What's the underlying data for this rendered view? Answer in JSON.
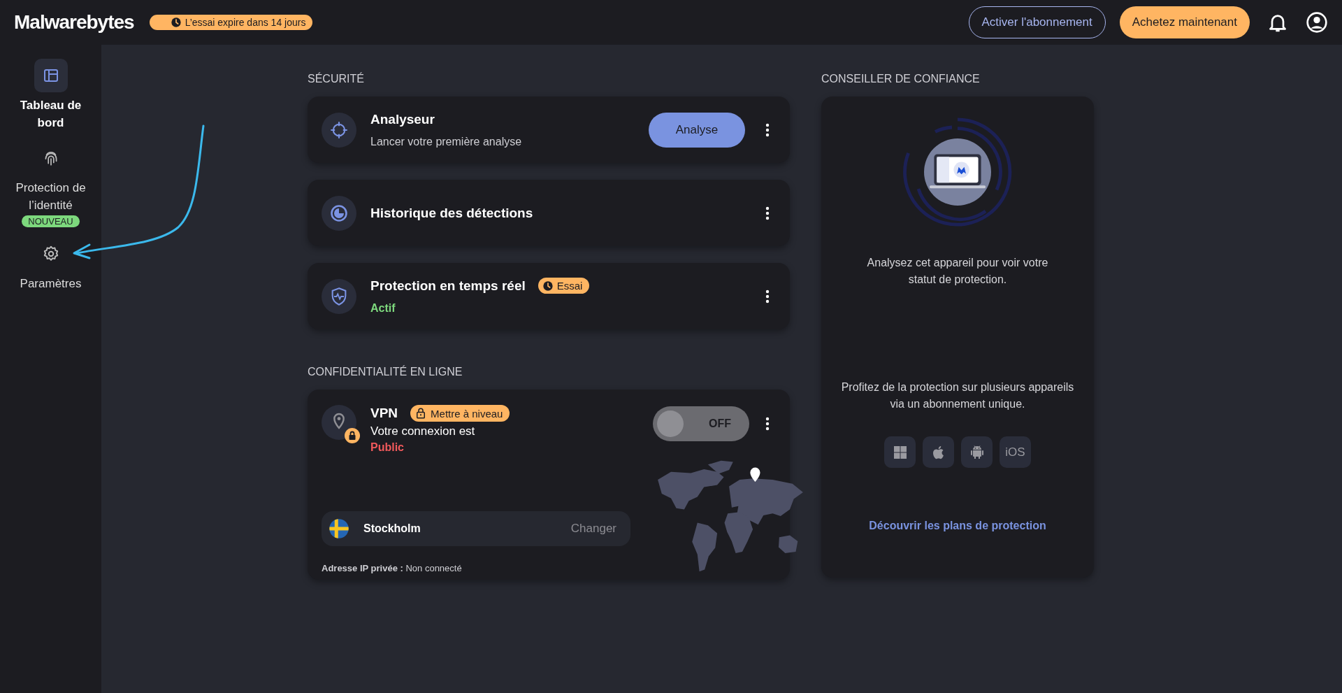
{
  "topbar": {
    "logo": "Malwarebytes",
    "trial_badge": "L’essai expire dans 14 jours",
    "buttons": [
      {
        "label": "Activer l'abonnement",
        "kind": "outline"
      },
      {
        "label": "Achetez maintenant",
        "kind": "filled"
      }
    ]
  },
  "sidebar": {
    "items": [
      {
        "label": "Tableau de bord",
        "selected": true
      },
      {
        "label": "Protection de l’identité",
        "selected": false,
        "badge": "NOUVEAU"
      },
      {
        "label": "Paramètres",
        "selected": false
      }
    ]
  },
  "security": {
    "heading": "SÉCURITÉ",
    "cards": [
      {
        "kind": "action",
        "title": "Analyseur",
        "subtitle": "Lancer votre première analyse",
        "button": "Analyse"
      },
      {
        "kind": "plain",
        "title": "Historique des détections"
      },
      {
        "kind": "status",
        "title": "Protection en temps réel",
        "badge": "Essai",
        "status": "Actif"
      }
    ]
  },
  "privacy": {
    "heading": "CONFIDENTIALITÉ EN LIGNE",
    "vpn": {
      "title": "VPN",
      "badge": "Mettre à niveau",
      "connection_text": "Votre connexion est",
      "connection_status": "Public",
      "toggle": {
        "on": false,
        "label": "OFF"
      },
      "location": {
        "city": "Stockholm",
        "action": "Changer"
      },
      "ip_label": "Adresse IP privée :",
      "ip_value": "Non connecté"
    }
  },
  "advisor": {
    "heading": "CONSEILLER DE CONFIANCE",
    "message": "Analysez cet appareil pour voir votre statut de protection.",
    "promo": "Profitez de la protection sur plusieurs appareils via un abonnement unique.",
    "platforms": [
      {
        "kind": "windows"
      },
      {
        "kind": "apple"
      },
      {
        "kind": "android"
      },
      {
        "kind": "text",
        "label": "iOS"
      }
    ],
    "link": "Découvrir les plans de protection"
  }
}
